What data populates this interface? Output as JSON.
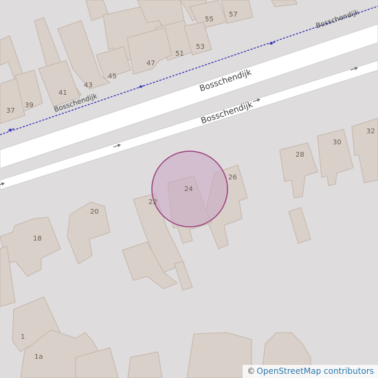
{
  "map": {
    "streets": {
      "main_upper": "Bosschendijk",
      "main_lower": "Bosschendijk",
      "side": "Bosschendijk"
    },
    "house_numbers": [
      "55",
      "57",
      "51",
      "53",
      "47",
      "45",
      "43",
      "41",
      "39",
      "37",
      "28",
      "30",
      "32",
      "26",
      "24",
      "22",
      "20",
      "18",
      "1",
      "1a"
    ],
    "marker": {
      "color": "#9a3c7c",
      "fill": "#c8a6c2"
    },
    "colors": {
      "background": "#dedcdc",
      "building": "#d9d0c9",
      "road": "#ffffff",
      "footpath": "#2f2fb8"
    }
  },
  "attribution": {
    "copyright_symbol": "©",
    "link_text": "OpenStreetMap contributors"
  }
}
